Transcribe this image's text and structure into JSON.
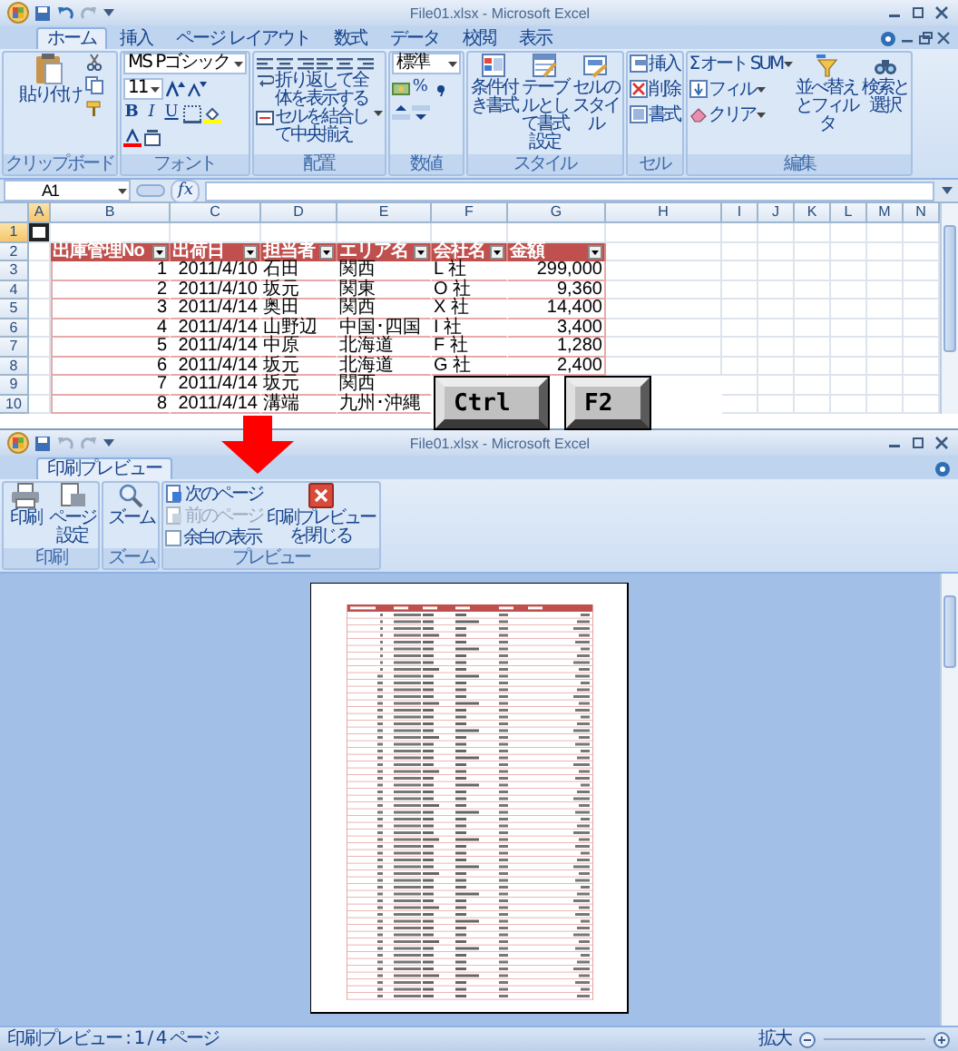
{
  "excel": {
    "title": "File01.xlsx - Microsoft Excel",
    "tabs": [
      {
        "label": "ホーム",
        "selected": true
      },
      {
        "label": "挿入",
        "selected": false
      },
      {
        "label": "ページ レイアウト",
        "selected": false
      },
      {
        "label": "数式",
        "selected": false
      },
      {
        "label": "データ",
        "selected": false
      },
      {
        "label": "校閲",
        "selected": false
      },
      {
        "label": "表示",
        "selected": false
      }
    ],
    "ribbon": {
      "clipboard": {
        "label": "クリップボード",
        "paste": "貼り付け"
      },
      "font": {
        "label": "フォント",
        "font_name": "MS Pゴシック",
        "font_size": "11",
        "bold": "B",
        "italic": "I",
        "underline": "U"
      },
      "alignment": {
        "label": "配置",
        "wrap_text": "折り返して全体を表示する",
        "merge": "セルを結合して中央揃え"
      },
      "number": {
        "label": "数値",
        "format": "標準",
        "percent": "%"
      },
      "styles": {
        "label": "スタイル",
        "buttons": [
          "条件付き書式",
          "テーブルとして書式設定",
          "セルのスタイル"
        ]
      },
      "cells": {
        "label": "セル",
        "buttons": [
          "挿入",
          "削除",
          "書式"
        ]
      },
      "editing": {
        "label": "編集",
        "autosum_symbol": "Σ",
        "autosum": "オート SUM",
        "fill": "フィル",
        "clear": "クリア",
        "buttons": [
          "並べ替えとフィルタ",
          "検索と選択"
        ]
      }
    },
    "name_box": "A1",
    "function_button": "fx",
    "column_headers": [
      {
        "label": "A",
        "selected": true
      },
      {
        "label": "B",
        "selected": false
      },
      {
        "label": "C",
        "selected": false
      },
      {
        "label": "D",
        "selected": false
      },
      {
        "label": "E",
        "selected": false
      },
      {
        "label": "F",
        "selected": false
      },
      {
        "label": "G",
        "selected": false
      },
      {
        "label": "H",
        "selected": false
      },
      {
        "label": "I",
        "selected": false
      },
      {
        "label": "J",
        "selected": false
      },
      {
        "label": "K",
        "selected": false
      },
      {
        "label": "L",
        "selected": false
      },
      {
        "label": "M",
        "selected": false
      },
      {
        "label": "N",
        "selected": false
      }
    ],
    "row_headers": [
      {
        "label": "1",
        "selected": true
      },
      {
        "label": "2",
        "selected": false
      },
      {
        "label": "3",
        "selected": false
      },
      {
        "label": "4",
        "selected": false
      },
      {
        "label": "5",
        "selected": false
      },
      {
        "label": "6",
        "selected": false
      },
      {
        "label": "7",
        "selected": false
      },
      {
        "label": "8",
        "selected": false
      },
      {
        "label": "9",
        "selected": false
      },
      {
        "label": "10",
        "selected": false
      }
    ],
    "table": {
      "headers": [
        "出庫管理No",
        "出荷日",
        "担当者",
        "エリア名",
        "会社名",
        "金額"
      ],
      "rows": [
        [
          "1",
          "2011/4/10",
          "石田",
          "関西",
          "L 社",
          "299,000"
        ],
        [
          "2",
          "2011/4/10",
          "坂元",
          "関東",
          "O 社",
          "9,360"
        ],
        [
          "3",
          "2011/4/14",
          "奥田",
          "関西",
          "X 社",
          "14,400"
        ],
        [
          "4",
          "2011/4/14",
          "山野辺",
          "中国･四国",
          "I 社",
          "3,400"
        ],
        [
          "5",
          "2011/4/14",
          "中原",
          "北海道",
          "F 社",
          "1,280"
        ],
        [
          "6",
          "2011/4/14",
          "坂元",
          "北海道",
          "G 社",
          "2,400"
        ],
        [
          "7",
          "2011/4/14",
          "坂元",
          "関西"
        ],
        [
          "8",
          "2011/4/14",
          "溝端",
          "九州･沖縄"
        ]
      ]
    }
  },
  "keys": [
    "Ctrl",
    "F2"
  ],
  "preview": {
    "title": "File01.xlsx - Microsoft Excel",
    "tabs": [
      {
        "label": "印刷プレビュー",
        "selected": true
      }
    ],
    "ribbon": {
      "print": {
        "label": "印刷",
        "print": "印刷",
        "page_setup": "ページ設定"
      },
      "zoom": {
        "label": "ズーム",
        "zoom": "ズーム"
      },
      "preview": {
        "label": "プレビュー",
        "next_page": {
          "label": "次のページ",
          "disabled": false
        },
        "previous_page": {
          "label": "前のページ",
          "disabled": true
        },
        "show_margins": {
          "label": "余白の表示",
          "checked": false
        },
        "close": "印刷プレビューを閉じる"
      }
    },
    "status": "印刷プレビュー : 1 / 4 ページ",
    "zoom_label": "拡大"
  }
}
